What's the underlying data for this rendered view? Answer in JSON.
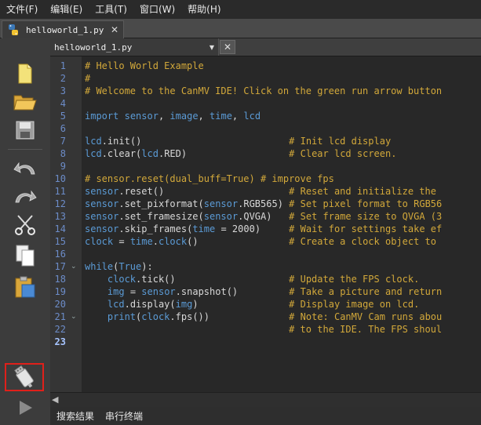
{
  "menubar": {
    "items": [
      "文件(F)",
      "编辑(E)",
      "工具(T)",
      "窗口(W)",
      "帮助(H)"
    ]
  },
  "doc_tab": {
    "label": "helloworld_1.py",
    "close": "✕",
    "icon": "python-file-icon"
  },
  "editor": {
    "file_selector": "helloworld_1.py",
    "dropdown_arrow": "▼",
    "close": "✕",
    "line_numbers": [
      "1",
      "2",
      "3",
      "4",
      "5",
      "6",
      "7",
      "8",
      "9",
      "10",
      "11",
      "12",
      "13",
      "14",
      "15",
      "16",
      "17",
      "18",
      "19",
      "20",
      "21",
      "22",
      "23"
    ],
    "current_line": "23",
    "fold_markers": [
      "17",
      "21"
    ],
    "lines": [
      "# Hello World Example",
      "#",
      "# Welcome to the CanMV IDE! Click on the green run arrow button",
      "",
      "import sensor, image, time, lcd",
      "",
      "lcd.init()                          # Init lcd display",
      "lcd.clear(lcd.RED)                  # Clear lcd screen.",
      "",
      "# sensor.reset(dual_buff=True) # improve fps",
      "sensor.reset()                      # Reset and initialize the",
      "sensor.set_pixformat(sensor.RGB565) # Set pixel format to RGB56",
      "sensor.set_framesize(sensor.QVGA)   # Set frame size to QVGA (3",
      "sensor.skip_frames(time = 2000)     # Wait for settings take ef",
      "clock = time.clock()                # Create a clock object to",
      "",
      "while(True):",
      "    clock.tick()                    # Update the FPS clock.",
      "    img = sensor.snapshot()         # Take a picture and return",
      "    lcd.display(img)                # Display image on lcd.",
      "    print(clock.fps())              # Note: CanMV Cam runs abou",
      "                                    # to the IDE. The FPS shoul",
      ""
    ]
  },
  "toolbar": {
    "icons": [
      "new-file-icon",
      "open-folder-icon",
      "save-icon",
      "undo-icon",
      "redo-icon",
      "cut-icon",
      "copy-icon",
      "paste-icon",
      "connect-icon",
      "run-icon"
    ]
  },
  "bottom": {
    "tabs": [
      "搜索结果",
      "串行终端"
    ]
  },
  "colors": {
    "comment": "#d2a83a",
    "keyword": "#5b9bd6",
    "line_number": "#6c8cc8",
    "highlight_box": "#e0201a"
  }
}
